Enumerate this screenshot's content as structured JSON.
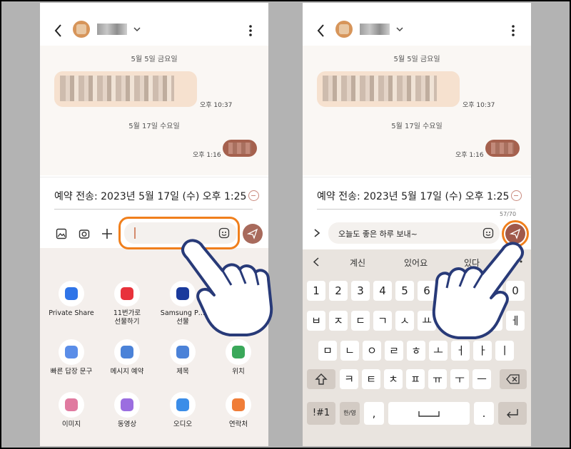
{
  "left": {
    "date1": "5월 5일 금요일",
    "time1": "오후 10:37",
    "date2": "5월 17일 수요일",
    "time2": "오후 1:16",
    "schedule": "예약 전송: 2023년 5월 17일 (수) 오후 1:25",
    "apps": [
      {
        "label": "Private Share",
        "color": "#2f74e8"
      },
      {
        "label": "11번가로\n선물하기",
        "color": "#e8323b"
      },
      {
        "label": "Samsung P…\n선물",
        "color": "#1a3a9c"
      },
      {
        "label": "빠른 답장 문구",
        "color": "#5a8de8"
      },
      {
        "label": "메시지 예약",
        "color": "#4b82d8"
      },
      {
        "label": "제목",
        "color": "#4b82d8"
      },
      {
        "label": "위치",
        "color": "#3aa85a"
      },
      {
        "label": "이미지",
        "color": "#e07aa0"
      },
      {
        "label": "동영상",
        "color": "#9b6ee0"
      },
      {
        "label": "오디오",
        "color": "#3b8de8"
      },
      {
        "label": "연락처",
        "color": "#f07d38"
      }
    ]
  },
  "right": {
    "date1": "5월 5일 금요일",
    "time1": "오후 10:37",
    "date2": "5월 17일 수요일",
    "time2": "오후 1:16",
    "schedule": "예약 전송: 2023년 5월 17일 (수) 오후 1:25",
    "counter": "57/70",
    "message": "오늘도 좋은 하루 보내~",
    "suggestions": [
      "계신",
      "있어요",
      "있다"
    ],
    "keys_row1": [
      "1",
      "2",
      "3",
      "4",
      "5",
      "6",
      "7",
      "8",
      "9",
      "0"
    ],
    "keys_row2": [
      "ㅂ",
      "ㅈ",
      "ㄷ",
      "ㄱ",
      "ㅅ",
      "ㅛ",
      "ㅕ",
      "ㅑ",
      "ㅐ",
      "ㅔ"
    ],
    "keys_row3": [
      "ㅁ",
      "ㄴ",
      "ㅇ",
      "ㄹ",
      "ㅎ",
      "ㅗ",
      "ㅓ",
      "ㅏ",
      "ㅣ"
    ],
    "keys_row4": [
      "ㅋ",
      "ㅌ",
      "ㅊ",
      "ㅍ",
      "ㅠ",
      "ㅜ",
      "ㅡ"
    ],
    "key_symbols": "!#1",
    "key_lang": "한/영",
    "key_comma": ",",
    "key_period": "."
  }
}
